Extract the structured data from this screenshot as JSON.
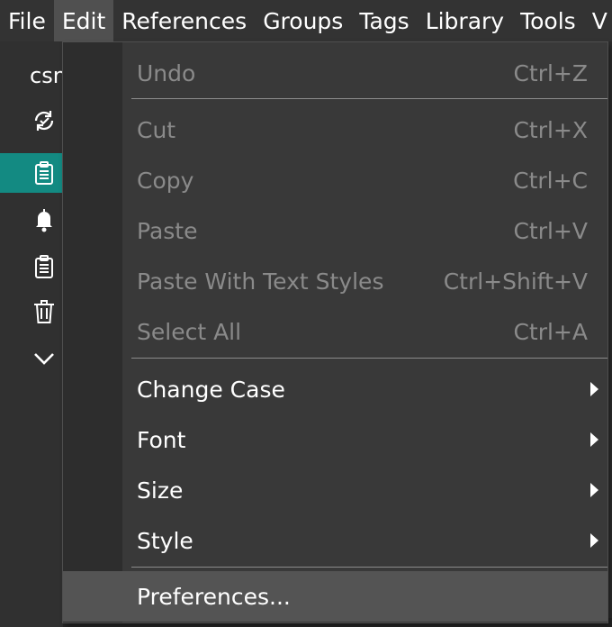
{
  "menubar": {
    "items": [
      {
        "label": "File"
      },
      {
        "label": "Edit"
      },
      {
        "label": "References"
      },
      {
        "label": "Groups"
      },
      {
        "label": "Tags"
      },
      {
        "label": "Library"
      },
      {
        "label": "Tools"
      },
      {
        "label": "V"
      }
    ]
  },
  "sidebar": {
    "library_name": "csn",
    "icons": [
      "sync-icon",
      "clipboard-icon",
      "bell-icon",
      "clipboard-icon",
      "trash-icon",
      "chevron-down-icon"
    ],
    "accent": "#138a82"
  },
  "edit_menu": {
    "items": [
      {
        "label": "Undo",
        "shortcut": "Ctrl+Z",
        "enabled": false
      },
      {
        "label": "Cut",
        "shortcut": "Ctrl+X",
        "enabled": false
      },
      {
        "label": "Copy",
        "shortcut": "Ctrl+C",
        "enabled": false
      },
      {
        "label": "Paste",
        "shortcut": "Ctrl+V",
        "enabled": false
      },
      {
        "label": "Paste With Text Styles",
        "shortcut": "Ctrl+Shift+V",
        "enabled": false
      },
      {
        "label": "Select All",
        "shortcut": "Ctrl+A",
        "enabled": false
      },
      {
        "label": "Change Case",
        "submenu": true,
        "enabled": true
      },
      {
        "label": "Font",
        "submenu": true,
        "enabled": true
      },
      {
        "label": "Size",
        "submenu": true,
        "enabled": true
      },
      {
        "label": "Style",
        "submenu": true,
        "enabled": true
      },
      {
        "label": "Preferences...",
        "enabled": true,
        "highlighted": true
      }
    ]
  },
  "colors": {
    "menu_bg": "#393939",
    "highlight": "#545454",
    "disabled_text": "#8a8a8a"
  }
}
